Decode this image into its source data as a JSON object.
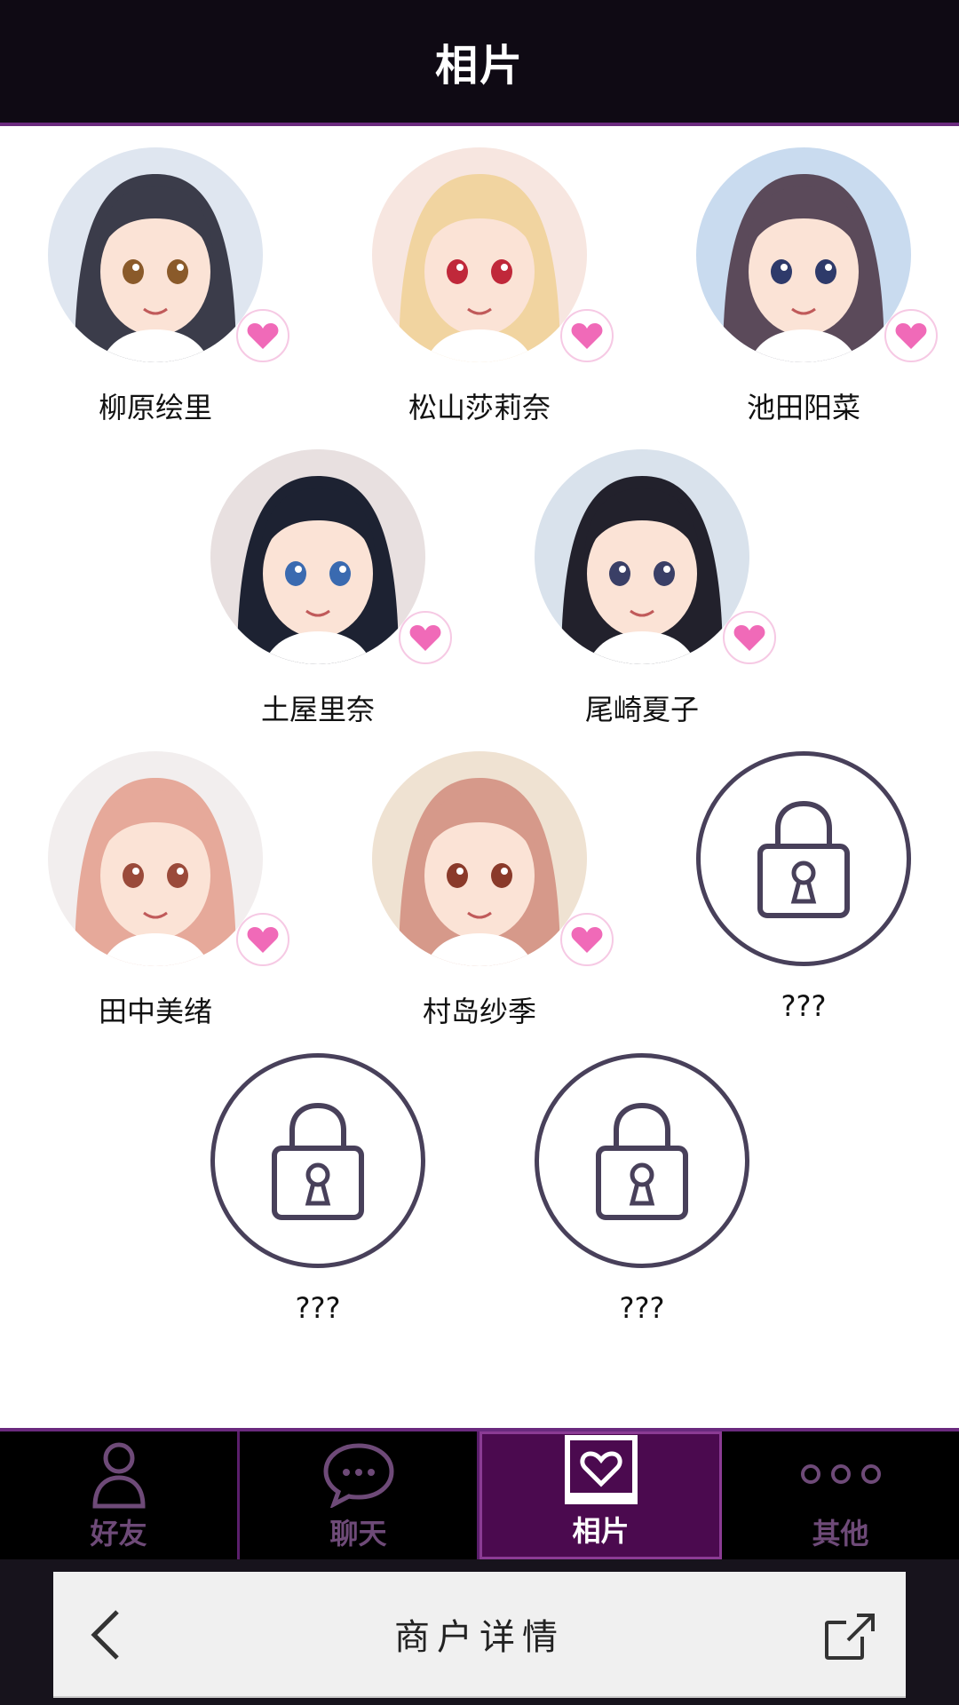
{
  "header": {
    "title": "相片"
  },
  "contacts": [
    {
      "name": "柳原绘里",
      "locked": false,
      "hair": "#3b3c4a",
      "eye": "#8a5a2a",
      "bg": "#dfe6f0"
    },
    {
      "name": "松山莎莉奈",
      "locked": false,
      "hair": "#f1d4a0",
      "eye": "#c0283a",
      "bg": "#f7e6e0"
    },
    {
      "name": "池田阳菜",
      "locked": false,
      "hair": "#5b4a5a",
      "eye": "#2e3a6a",
      "bg": "#c9dbef"
    },
    {
      "name": "土屋里奈",
      "locked": false,
      "hair": "#1d2232",
      "eye": "#3a6ab0",
      "bg": "#e8e0e0"
    },
    {
      "name": "尾崎夏子",
      "locked": false,
      "hair": "#22212c",
      "eye": "#3a3f66",
      "bg": "#d9e2ec"
    },
    {
      "name": "田中美绪",
      "locked": false,
      "hair": "#e6a99a",
      "eye": "#9a4a3a",
      "bg": "#f2eeee"
    },
    {
      "name": "村岛纱季",
      "locked": false,
      "hair": "#d6998a",
      "eye": "#8a3a2a",
      "bg": "#efe2d2"
    },
    {
      "name": "???",
      "locked": true
    },
    {
      "name": "???",
      "locked": true
    },
    {
      "name": "???",
      "locked": true
    }
  ],
  "tabs": [
    {
      "label": "好友",
      "icon": "person-icon",
      "active": false
    },
    {
      "label": "聊天",
      "icon": "chat-bubble-icon",
      "active": false
    },
    {
      "label": "相片",
      "icon": "photo-heart-icon",
      "active": true
    },
    {
      "label": "其他",
      "icon": "more-dots-icon",
      "active": false
    }
  ],
  "miniapp": {
    "title": "商户详情",
    "back_icon": "back-chevron-icon",
    "share_icon": "share-icon"
  },
  "colors": {
    "accent": "#6a2a7e",
    "active_tab": "#4b0a4f",
    "heart": "#f06ab8",
    "lock": "#48405a"
  }
}
